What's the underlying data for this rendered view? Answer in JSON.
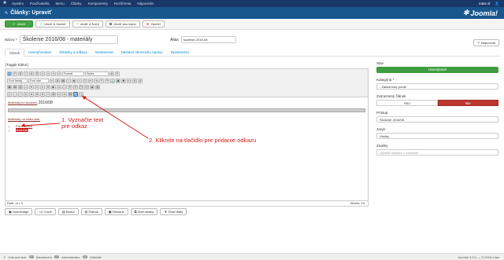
{
  "topnav": {
    "menu": [
      "Systém",
      "Používatelia",
      "Menu",
      "Články",
      "Komponenty",
      "Rozšírenia",
      "Nápoveda"
    ],
    "user": "Intax sl",
    "user_icon": "user-icon"
  },
  "header": {
    "title": "Články: Upraviť",
    "logo": "Joomla!"
  },
  "toolbar": {
    "save": "Uložiť",
    "save_close": "Uložiť & Zavrieť",
    "save_new": "Uložiť & Nový",
    "save_copy": "Uložiť ako kópiu",
    "close": "Zavrieť",
    "help": "Nápoveda"
  },
  "form": {
    "name_label": "Názov *",
    "name_value": "Školenie 2016/08 - materiály",
    "alias_label": "Alias",
    "alias_value": "skolenie-2016-08"
  },
  "tabs": [
    "Obsah",
    "Uverejňovanie",
    "Obrázky a odkazy",
    "Nastavenia",
    "Nastavit obrazovku úpravy",
    "Oprávnenia"
  ],
  "editor": {
    "toggle": "[Toggle Editor]",
    "format": "Format",
    "styles": "Styles",
    "font_family": "Font family",
    "font_size": "Font size",
    "content_link": "Materiály ku školeniu",
    "content_link_year": "2016/08",
    "list_heading": "Materiály na stiahnutie:",
    "list_items": [
      "Prezentácia",
      "Materiály"
    ],
    "path": "Path: ul » li",
    "words": "Words: 10"
  },
  "annotations": {
    "step1_line1": "1. Vyznačte text",
    "step1_line2": "pre odkaz",
    "step2": "2. Kliknite na tlačidlo pre pridanie odkazu"
  },
  "extra_buttons": [
    "Joomimage",
    "Code",
    "Modul",
    "Článok",
    "Obrázok",
    "Zlom strany",
    "Čítať ďalej"
  ],
  "sidebar": {
    "stav_label": "Stav",
    "stav_value": "Uverejnené",
    "kategoria_label": "Kategória *",
    "kategoria_value": "- Zákaznícky portál",
    "zvyrazneny_label": "Zvýraznený článok",
    "ano": "Áno",
    "nie": "Nie",
    "pristup_label": "Prístup",
    "pristup_value": "Školenie 2016/08",
    "jazyk_label": "Jazyk",
    "jazyk_value": "Všetky",
    "znacky_label": "Značky",
    "znacky_placeholder": "Vyberte niektoré z možností"
  },
  "footer": {
    "view_site": "Zobraziť web",
    "visitors_count": "0",
    "visitors": "Návštevníci",
    "admins_count": "1",
    "admins": "Administrátor",
    "logout_count": "0",
    "logout": "Odhlásiť",
    "copyright": "Joomla! 3.5.1 — © 2016 Intax"
  },
  "colors": {
    "topnav": "#1a3867",
    "header": "#17578e",
    "accent_green": "#46a546",
    "danger": "#bd362f",
    "annotation": "#d21b1b"
  }
}
